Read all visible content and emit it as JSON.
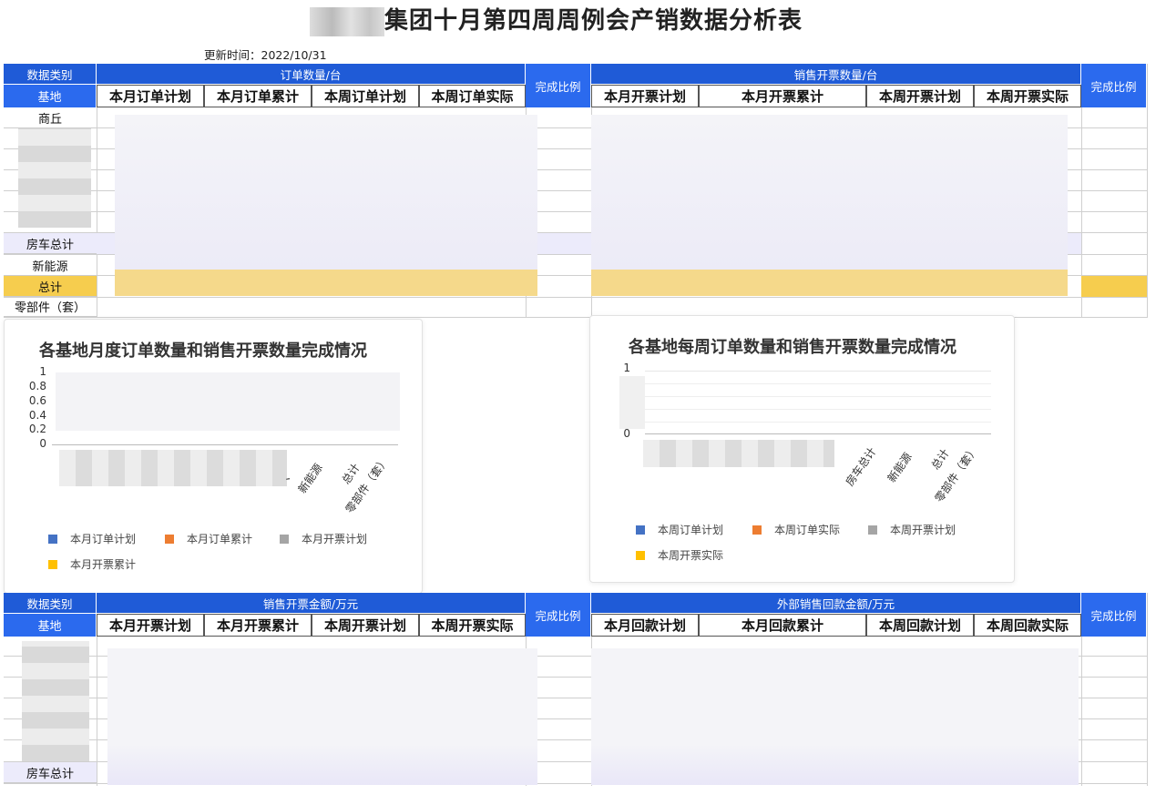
{
  "title": "集团十月第四周周例会产销数据分析表",
  "updated": "更新时间：2022/10/31",
  "table1": {
    "category_label": "数据类别",
    "base_label": "基地",
    "group_a": "订单数量/台",
    "group_b": "销售开票数量/台",
    "ratio": "完成比例",
    "cols_a": [
      "本月订单计划",
      "本月订单累计",
      "本周订单计划",
      "本周订单实际"
    ],
    "cols_b": [
      "本月开票计划",
      "本月开票累计",
      "本周开票计划",
      "本周开票实际"
    ],
    "rows": [
      "商丘",
      "房车总计",
      "新能源",
      "总计",
      "零部件（套）"
    ]
  },
  "chart1": {
    "title": "各基地月度订单数量和销售开票数量完成情况",
    "yticks": [
      "1",
      "0.8",
      "0.6",
      "0.4",
      "0.2",
      "0"
    ],
    "xlabels": [
      "、",
      "新能源",
      "总计",
      "零部件（套）"
    ],
    "legend": [
      "本月订单计划",
      "本月订单累计",
      "本月开票计划",
      "本月开票累计"
    ],
    "colors": [
      "#4472c4",
      "#ed7d31",
      "#a5a5a5",
      "#ffc000"
    ]
  },
  "chart2": {
    "title": "各基地每周订单数量和销售开票数量完成情况",
    "yticks": [
      "1",
      "0"
    ],
    "xlabels": [
      "房车总计",
      "新能源",
      "总计",
      "零部件（套）"
    ],
    "legend": [
      "本周订单计划",
      "本周订单实际",
      "本周开票计划",
      "本周开票实际"
    ],
    "colors": [
      "#4472c4",
      "#ed7d31",
      "#a5a5a5",
      "#ffc000"
    ]
  },
  "chart_data": [
    {
      "type": "bar",
      "title": "各基地月度订单数量和销售开票数量完成情况",
      "categories": [
        "、",
        "新能源",
        "总计",
        "零部件（套）"
      ],
      "ylim": [
        0,
        1
      ],
      "series": [
        {
          "name": "本月订单计划",
          "values": [
            0,
            0,
            0,
            0
          ]
        },
        {
          "name": "本月订单累计",
          "values": [
            0,
            0,
            0,
            0
          ]
        },
        {
          "name": "本月开票计划",
          "values": [
            0,
            0,
            0,
            0
          ]
        },
        {
          "name": "本月开票累计",
          "values": [
            0,
            0,
            0,
            0
          ]
        }
      ],
      "legend": "bottom"
    },
    {
      "type": "bar",
      "title": "各基地每周订单数量和销售开票数量完成情况",
      "categories": [
        "房车总计",
        "新能源",
        "总计",
        "零部件（套）"
      ],
      "ylim": [
        0,
        1
      ],
      "series": [
        {
          "name": "本周订单计划",
          "values": [
            0,
            0,
            0,
            0
          ]
        },
        {
          "name": "本周订单实际",
          "values": [
            0,
            0,
            0,
            0
          ]
        },
        {
          "name": "本周开票计划",
          "values": [
            0,
            0,
            0,
            0
          ]
        },
        {
          "name": "本周开票实际",
          "values": [
            0,
            0,
            0,
            0
          ]
        }
      ],
      "legend": "bottom"
    }
  ],
  "table2": {
    "category_label": "数据类别",
    "base_label": "基地",
    "group_a": "销售开票金额/万元",
    "group_b": "外部销售回款金额/万元",
    "ratio": "完成比例",
    "cols_a": [
      "本月开票计划",
      "本月开票累计",
      "本周开票计划",
      "本周开票实际"
    ],
    "cols_b": [
      "本月回款计划",
      "本月回款累计",
      "本周回款计划",
      "本周回款实际"
    ],
    "rows": [
      "房车总计"
    ]
  }
}
